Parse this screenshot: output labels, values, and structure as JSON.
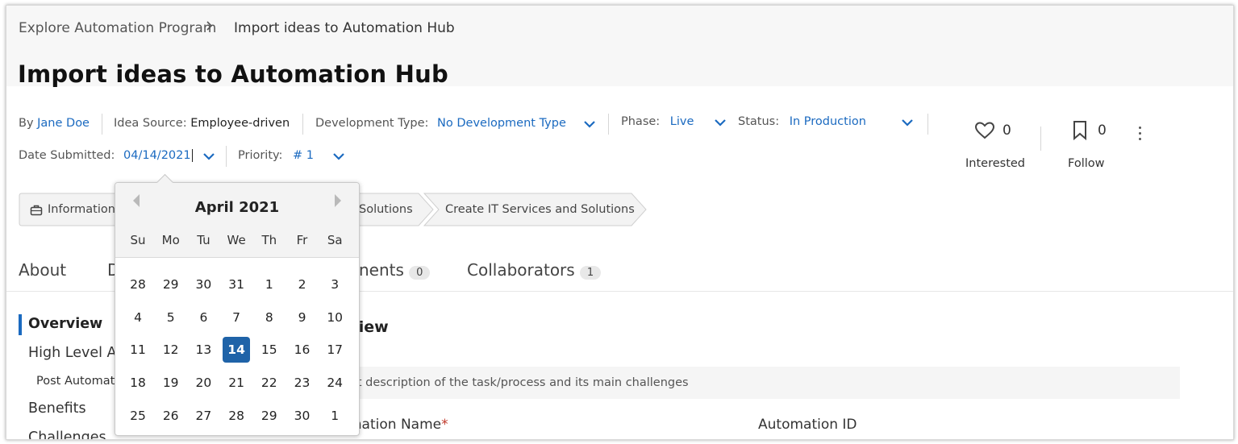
{
  "breadcrumb": {
    "parent": "Explore Automation Program",
    "current": "Import ideas to Automation Hub"
  },
  "page_title": "Import ideas to Automation Hub",
  "meta": {
    "by_label": "By",
    "author": "Jane Doe",
    "idea_source_label": "Idea Source:",
    "idea_source_value": "Employee-driven",
    "dev_type_label": "Development Type:",
    "dev_type_value": "No Development Type",
    "phase_label": "Phase:",
    "phase_value": "Live",
    "status_label": "Status:",
    "status_value": "In Production",
    "date_label": "Date Submitted:",
    "date_value": "04/14/2021",
    "priority_label": "Priority:",
    "priority_value": "# 1"
  },
  "actions": {
    "interested_count": "0",
    "interested_label": "Interested",
    "follow_count": "0",
    "follow_label": "Follow"
  },
  "stages": [
    "Information",
    "Solutions",
    "Create IT Services and Solutions"
  ],
  "tabs": {
    "about": "About",
    "d_partial": "D",
    "comments_partial": "nents",
    "comments_count": "0",
    "collaborators": "Collaborators",
    "collaborators_count": "1"
  },
  "left_nav": {
    "overview": "Overview",
    "high_level": "High Level As",
    "post_automation": "Post Automat",
    "benefits": "Benefits",
    "challenges": "Challenges"
  },
  "content": {
    "section_partial": "rview",
    "description_partial": "ort description of the task/process and its main challenges",
    "automation_name_partial": "mation Name",
    "required_mark": "*",
    "automation_id_label": "Automation ID"
  },
  "calendar": {
    "title": "April 2021",
    "weekdays": [
      "Su",
      "Mo",
      "Tu",
      "We",
      "Th",
      "Fr",
      "Sa"
    ],
    "weeks": [
      [
        "28",
        "29",
        "30",
        "31",
        "1",
        "2",
        "3"
      ],
      [
        "4",
        "5",
        "6",
        "7",
        "8",
        "9",
        "10"
      ],
      [
        "11",
        "12",
        "13",
        "14",
        "15",
        "16",
        "17"
      ],
      [
        "18",
        "19",
        "20",
        "21",
        "22",
        "23",
        "24"
      ],
      [
        "25",
        "26",
        "27",
        "28",
        "29",
        "30",
        "1"
      ]
    ],
    "selected_day": "14"
  },
  "colors": {
    "accent": "#1b6ac0",
    "selected_day_bg": "#1f63a8",
    "required": "#c0392b"
  }
}
